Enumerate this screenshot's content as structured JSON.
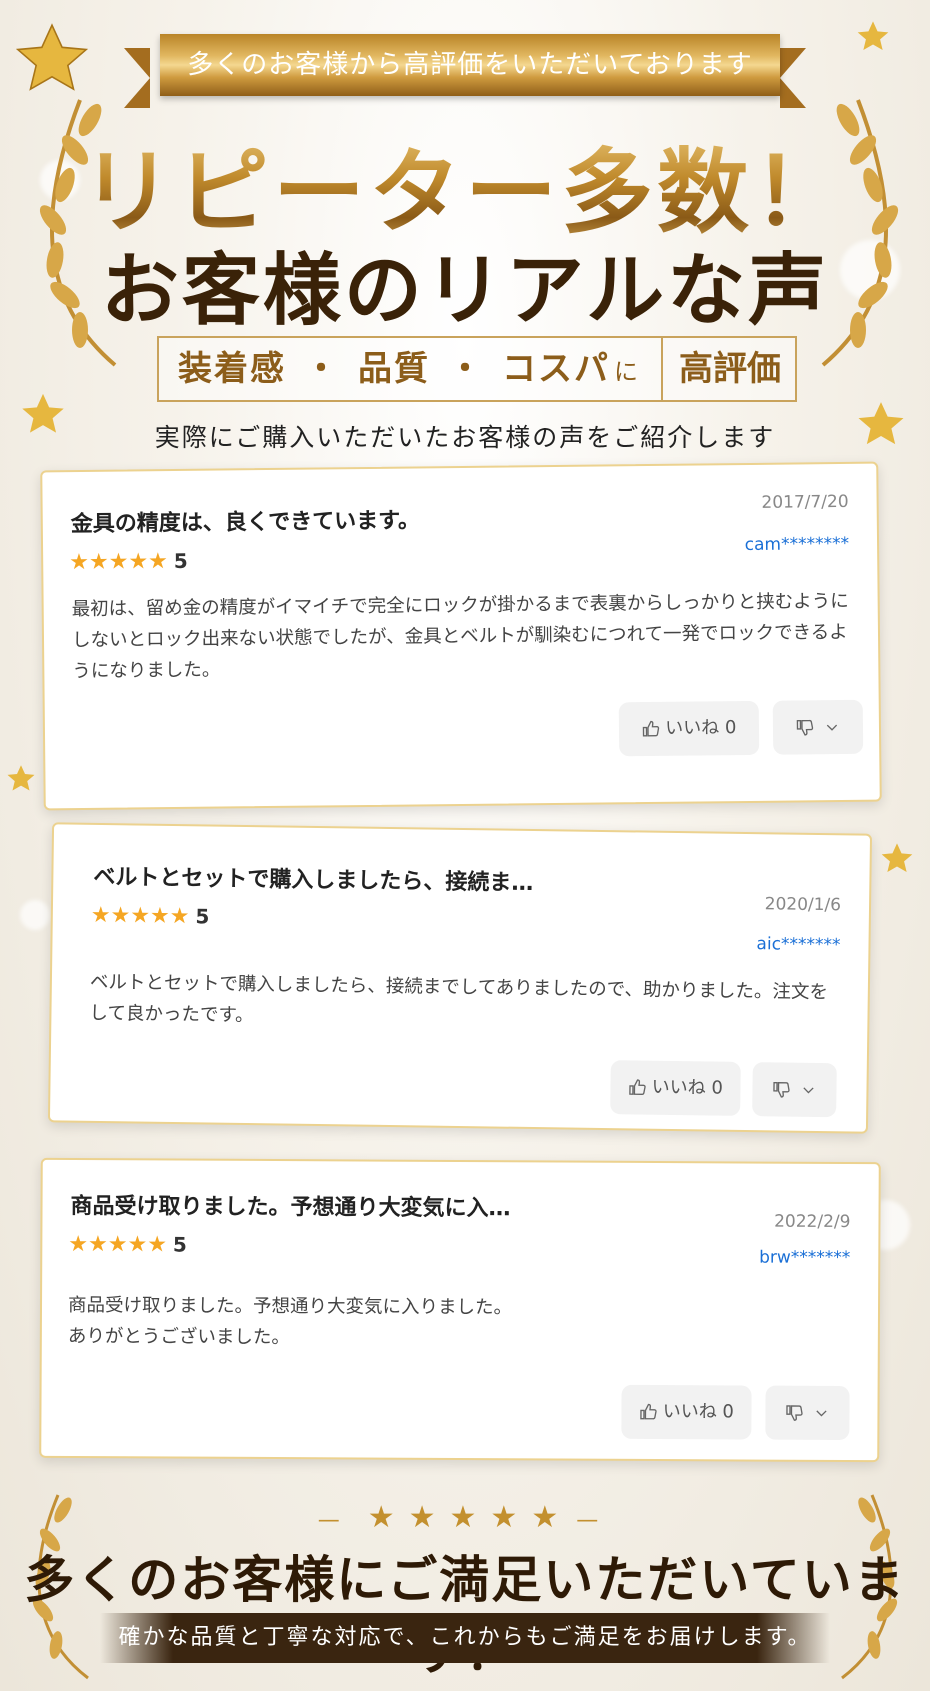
{
  "header": {
    "ribbon_text": "多くのお客様から高評価をいただいております",
    "headline_1": "リピーター多数！",
    "headline_2": "お客様のリアルな声",
    "tag_main_1": "装着感",
    "tag_dot_1": "・",
    "tag_main_2": "品質",
    "tag_dot_2": "・",
    "tag_main_3": "コスパ",
    "tag_particle": "に",
    "tag_right": "高評価",
    "subline": "実際にご購入いただいたお客様の声をご紹介します"
  },
  "reviews": [
    {
      "title": "金具の精度は、良くできています。",
      "date": "2017/7/20",
      "user": "cam********",
      "stars": "★★★★★",
      "score": "5",
      "body": "最初は、留め金の精度がイマイチで完全にロックが掛かるまで表裏からしっかりと挟むようにしないとロック出来ない状態でしたが、金具とベルトが馴染むにつれて一発でロックできるようになりました。",
      "like_label": "いいね 0"
    },
    {
      "title": "ベルトとセットで購入しましたら、接続ま…",
      "date": "2020/1/6",
      "user": "aic*******",
      "stars": "★★★★★",
      "score": "5",
      "body": "ベルトとセットで購入しましたら、接続までしてありましたので、助かりました。注文をして良かったです。",
      "like_label": "いいね 0"
    },
    {
      "title": "商品受け取りました。予想通り大変気に入…",
      "date": "2022/2/9",
      "user": "brw*******",
      "stars": "★★★★★",
      "score": "5",
      "body_line1": "商品受け取りました。予想通り大変気に入りました。",
      "body_line2": "ありがとうございました。",
      "like_label": "いいね 0"
    }
  ],
  "footer": {
    "stars": "★★★★★",
    "dash_left": "—",
    "dash_right": "—",
    "headline": "多くのお客様にご満足いただいています！",
    "band_text": "確かな品質と丁寧な対応で、これからもご満足をお届けします。"
  },
  "colors": {
    "gold": "#c3902f",
    "dark_brown": "#3a2208",
    "star": "#f5a623",
    "user_link": "#1a6fd6"
  }
}
